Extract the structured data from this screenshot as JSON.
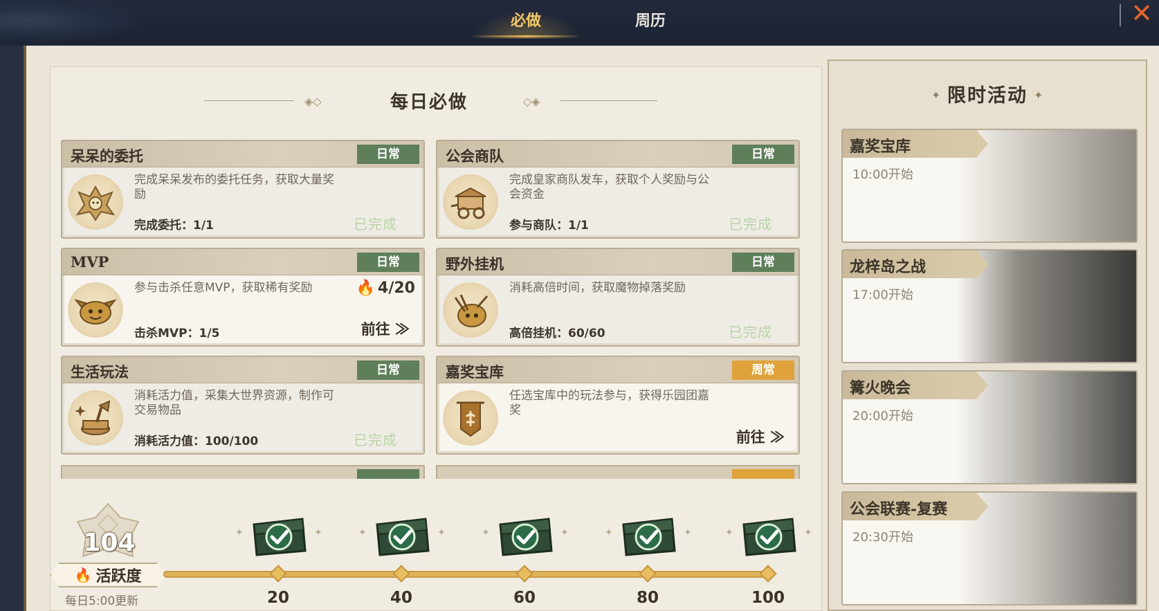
{
  "tabs": {
    "must_do": "必做",
    "calendar": "周历"
  },
  "daily": {
    "title": "每日必做",
    "tasks": [
      {
        "title": "呆呆的委托",
        "tag": "日常",
        "desc": "完成呆呆发布的委托任务，获取大量奖励",
        "progress": "完成委托：1/1",
        "status": "已完成"
      },
      {
        "title": "公会商队",
        "tag": "日常",
        "desc": "完成皇家商队发车，获取个人奖励与公会资金",
        "progress": "参与商队：1/1",
        "status": "已完成"
      },
      {
        "title": "MVP",
        "tag": "日常",
        "desc": "参与击杀任意MVP，获取稀有奖励",
        "progress": "击杀MVP：1/5",
        "reward": "4/20",
        "action": "前往 ≫"
      },
      {
        "title": "野外挂机",
        "tag": "日常",
        "desc": "消耗高倍时间，获取魔物掉落奖励",
        "progress": "高倍挂机：60/60",
        "status": "已完成"
      },
      {
        "title": "生活玩法",
        "tag": "日常",
        "desc": "消耗活力值，采集大世界资源，制作可交易物品",
        "progress": "消耗活力值：100/100",
        "status": "已完成"
      },
      {
        "title": "嘉奖宝库",
        "tag": "周常",
        "desc": "任选宝库中的玩法参与，获得乐园团嘉奖",
        "action": "前往 ≫"
      }
    ]
  },
  "activity": {
    "value": "104",
    "label": "活跃度",
    "reset": "每日5:00更新",
    "milestones": [
      "20",
      "40",
      "60",
      "80",
      "100"
    ]
  },
  "events": {
    "title": "限时活动",
    "items": [
      {
        "name": "嘉奖宝库",
        "time": "10:00开始"
      },
      {
        "name": "龙梓岛之战",
        "time": "17:00开始"
      },
      {
        "name": "篝火晚会",
        "time": "20:00开始"
      },
      {
        "name": "公会联赛-复赛",
        "time": "20:30开始"
      }
    ]
  },
  "colors": {
    "daily_tag": "#5e7f5a",
    "weekly_tag": "#e0a23a",
    "accent": "#f2c96d",
    "close": "#e0652a"
  }
}
